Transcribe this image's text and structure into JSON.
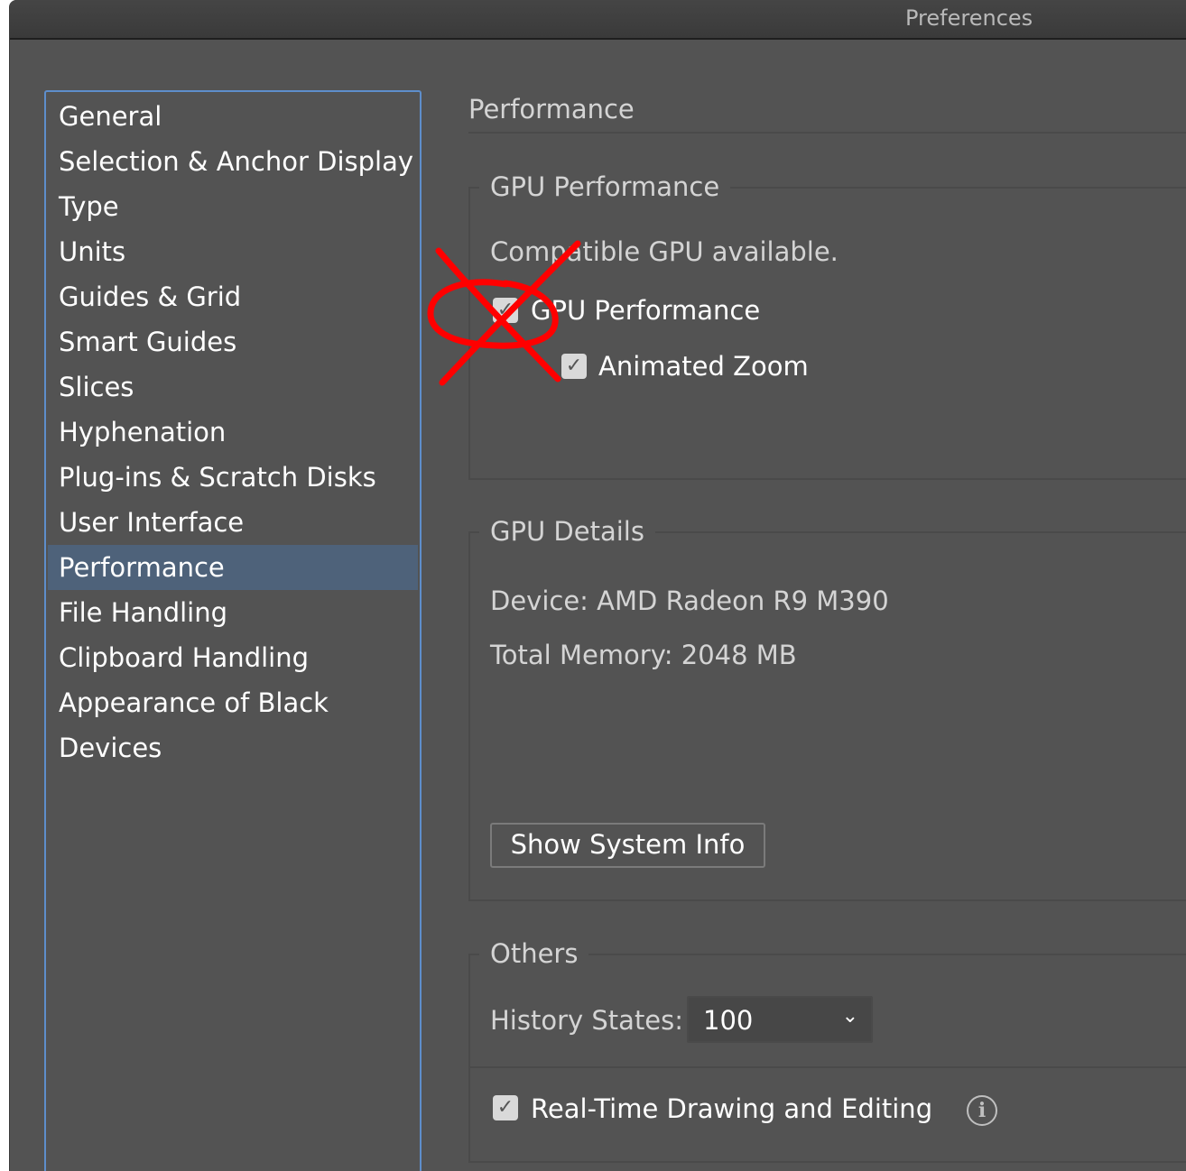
{
  "window": {
    "title": "Preferences"
  },
  "sidebar": {
    "items": [
      {
        "label": "General"
      },
      {
        "label": "Selection & Anchor Display"
      },
      {
        "label": "Type"
      },
      {
        "label": "Units"
      },
      {
        "label": "Guides & Grid"
      },
      {
        "label": "Smart Guides"
      },
      {
        "label": "Slices"
      },
      {
        "label": "Hyphenation"
      },
      {
        "label": "Plug-ins & Scratch Disks"
      },
      {
        "label": "User Interface"
      },
      {
        "label": "Performance",
        "selected": true
      },
      {
        "label": "File Handling"
      },
      {
        "label": "Clipboard Handling"
      },
      {
        "label": "Appearance of Black"
      },
      {
        "label": "Devices"
      }
    ]
  },
  "main": {
    "heading": "Performance",
    "gpu_performance": {
      "legend": "GPU Performance",
      "status": "Compatible GPU available.",
      "gpu_checkbox_label": "GPU Performance",
      "gpu_checked": true,
      "animated_zoom_label": "Animated Zoom",
      "animated_zoom_checked": true
    },
    "gpu_details": {
      "legend": "GPU Details",
      "device": "Device: AMD Radeon R9 M390",
      "memory": "Total Memory: 2048 MB",
      "show_system_info": "Show System Info"
    },
    "others": {
      "legend": "Others",
      "history_label": "History States:",
      "history_value": "100",
      "realtime_label": "Real-Time Drawing and Editing",
      "realtime_checked": true
    }
  },
  "icons": {
    "checkmark": "✓",
    "chevron": "⌄",
    "info": "i"
  },
  "colors": {
    "background": "#535353",
    "selection": "#4e627a",
    "focus_border": "#5e8ecb",
    "annotation": "#ff0000"
  }
}
